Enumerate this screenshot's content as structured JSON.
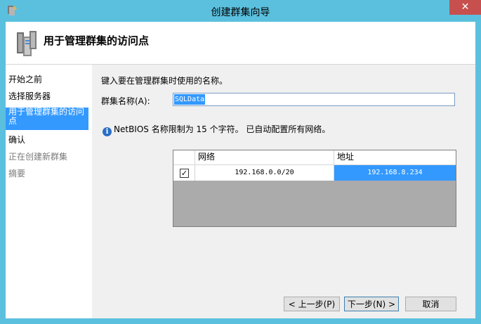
{
  "window": {
    "title": "创建群集向导",
    "close_glyph": "✕"
  },
  "header": {
    "title": "用于管理群集的访问点"
  },
  "nav": {
    "items": [
      {
        "label": "开始之前"
      },
      {
        "label": "选择服务器"
      },
      {
        "label": "用于管理群集的访问点"
      },
      {
        "label": "确认"
      },
      {
        "label": "正在创建新群集"
      },
      {
        "label": "摘要"
      }
    ]
  },
  "main": {
    "prompt": "键入要在管理群集时使用的名称。",
    "cluster_name_label": "群集名称(A):",
    "cluster_name_value": "SQLData",
    "info_icon": "i",
    "info_text": "NetBIOS 名称限制为 15 个字符。 已自动配置所有网络。",
    "grid": {
      "columns": [
        "网络",
        "地址"
      ],
      "rows": [
        {
          "checked": true,
          "check_glyph": "✓",
          "network": "192.168.0.0/20",
          "address": "192.168.8.234"
        }
      ]
    }
  },
  "buttons": {
    "back": "< 上一步(P)",
    "next": "下一步(N) >",
    "cancel": "取消"
  },
  "colors": {
    "titlebar": "#5bc0de",
    "selection": "#3399ff",
    "close": "#c7504f"
  }
}
